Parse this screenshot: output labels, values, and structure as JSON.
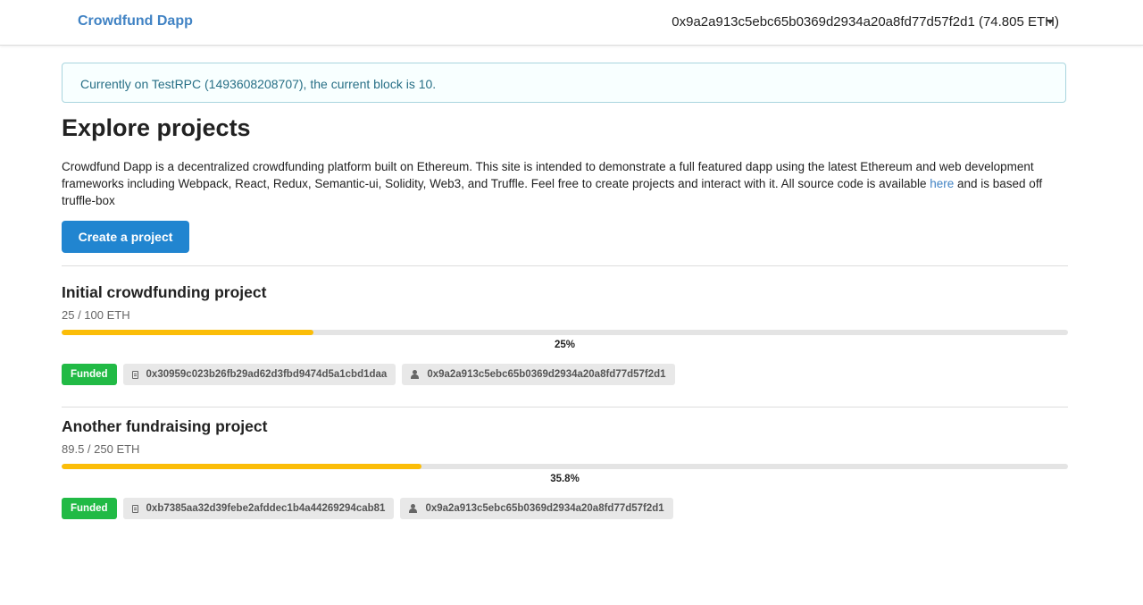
{
  "header": {
    "brand": "Crowdfund Dapp",
    "account": "0x9a2a913c5ebc65b0369d2934a20a8fd77d57f2d1 (74.805 ETH)"
  },
  "notice": {
    "text": "Currently on TestRPC (1493608208707), the current block is 10."
  },
  "main": {
    "title": "Explore projects",
    "intro_before": "Crowdfund Dapp is a decentralized crowdfunding platform built on Ethereum. This site is intended to demonstrate a full featured dapp using the latest Ethereum and web development frameworks including Webpack, React, Redux, Semantic-ui, Solidity, Web3, and Truffle. Feel free to create projects and interact with it. All source code is available ",
    "intro_link": "here",
    "intro_after": " and is based off truffle-box",
    "create_label": "Create a project"
  },
  "projects": [
    {
      "name": "Initial crowdfunding project",
      "amount": "25 / 100 ETH",
      "progress_pct": 25,
      "progress_label": "25%",
      "status": "Funded",
      "contract": "0x30959c023b26fb29ad62d3fbd9474d5a1cbd1daa",
      "creator": "0x9a2a913c5ebc65b0369d2934a20a8fd77d57f2d1"
    },
    {
      "name": "Another fundraising project",
      "amount": "89.5 / 250 ETH",
      "progress_pct": 35.8,
      "progress_label": "35.8%",
      "status": "Funded",
      "contract": "0xb7385aa32d39febe2afddec1b4a44269294cab81",
      "creator": "0x9a2a913c5ebc65b0369d2934a20a8fd77d57f2d1"
    }
  ],
  "colors": {
    "accent": "#2185d0",
    "brand": "#4183c4",
    "progress": "#fbbd08",
    "funded": "#21ba45",
    "notice_bg": "#f8ffff",
    "notice_text": "#276f86"
  },
  "icons": {
    "contract": "file-text-icon",
    "creator": "user-icon",
    "account_menu": "caret-down-icon"
  }
}
